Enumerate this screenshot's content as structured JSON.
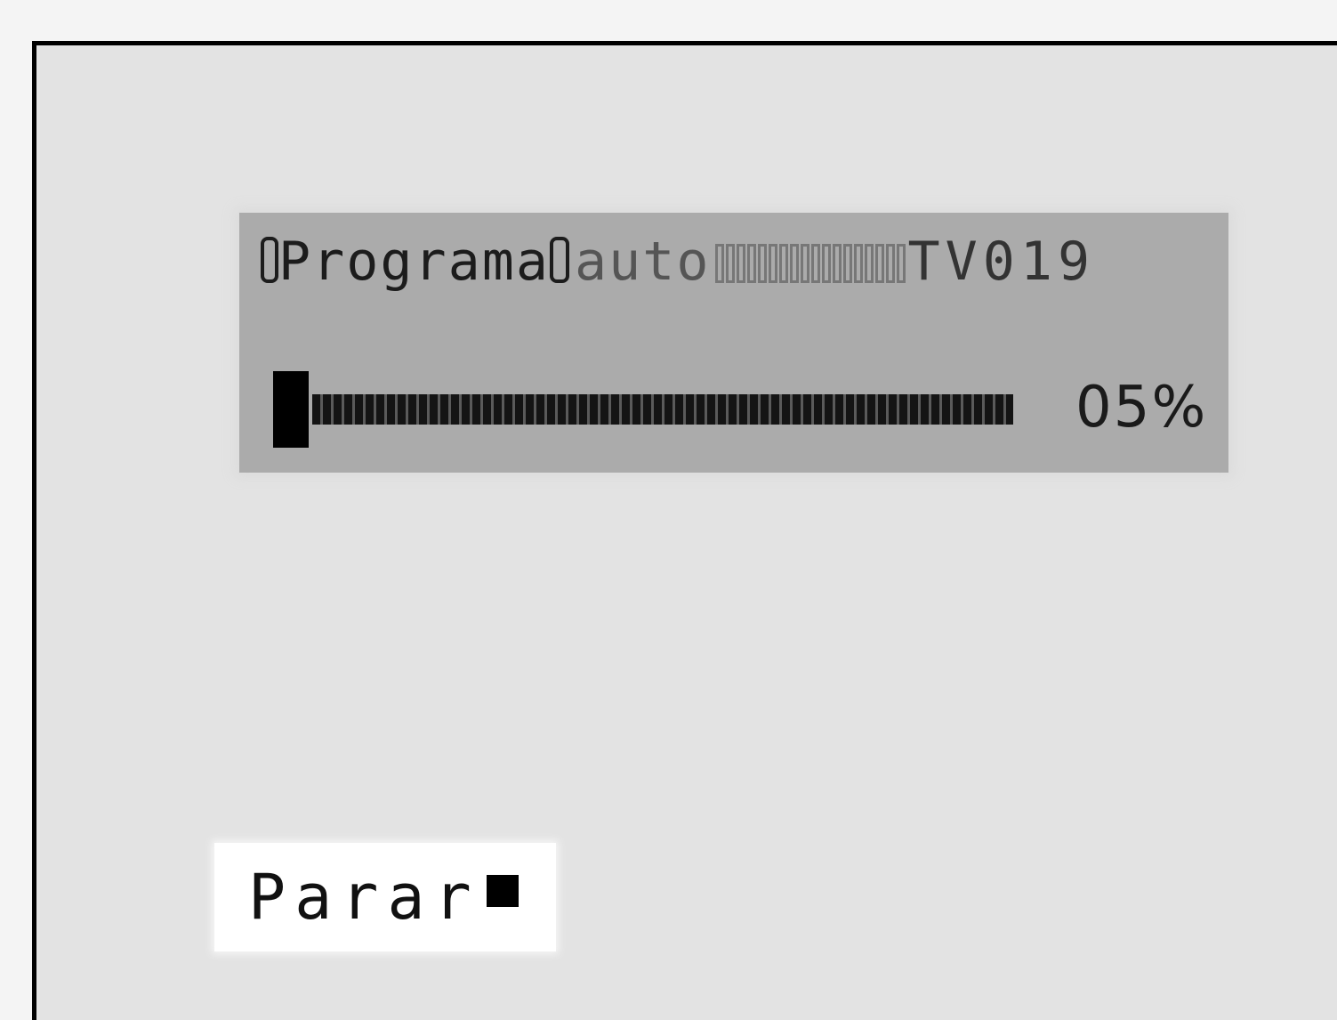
{
  "tuning": {
    "label": "Programa",
    "mode": "auto",
    "channel": "TV019"
  },
  "progress": {
    "value_percent": 5,
    "percent_text": "05%"
  },
  "controls": {
    "stop_label": "Parar"
  },
  "icons": {
    "stop": "stop-square-icon"
  }
}
